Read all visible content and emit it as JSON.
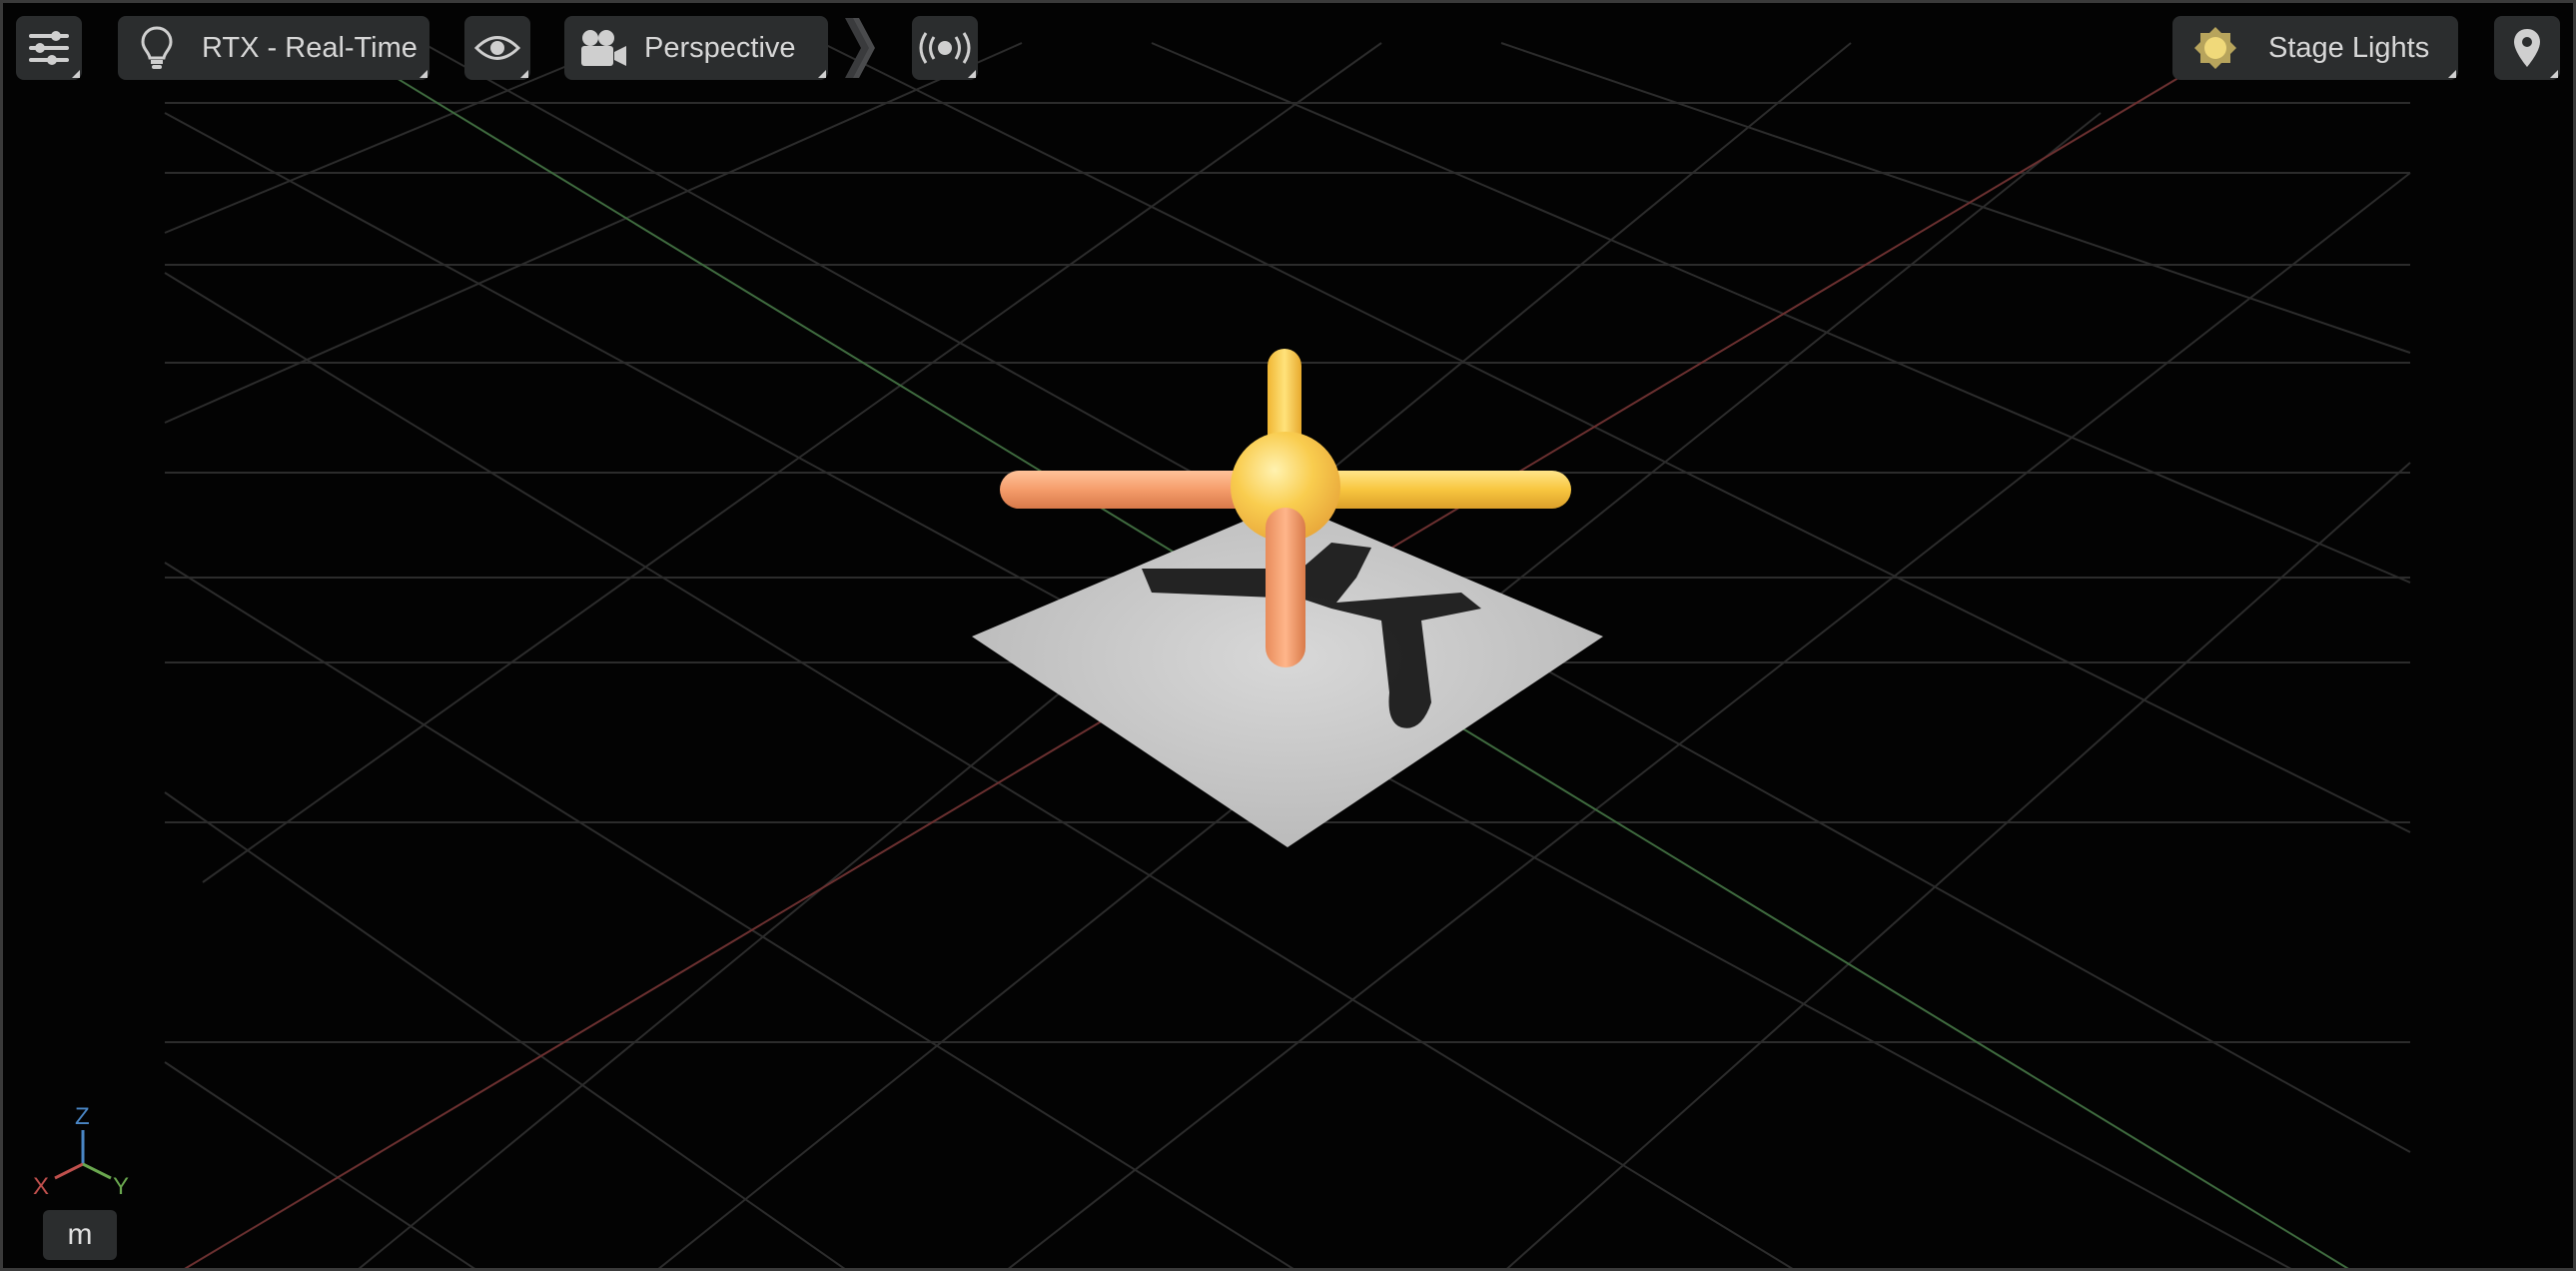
{
  "toolbar": {
    "renderer_label": "RTX - Real-Time",
    "camera_label": "Perspective",
    "lighting_label": "Stage Lights"
  },
  "icons": {
    "settings": "sliders-icon",
    "renderer": "lightbulb-icon",
    "visibility": "eye-icon",
    "camera": "movie-camera-icon",
    "expand": "chevron-right-double-icon",
    "broadcast": "broadcast-icon",
    "lighting": "sun-icon",
    "location": "map-pin-icon"
  },
  "gizmo": {
    "x_label": "X",
    "y_label": "Y",
    "z_label": "Z",
    "x_color": "#c0504d",
    "y_color": "#6aa84f",
    "z_color": "#4a86c5"
  },
  "unit": "m",
  "colors": {
    "toolbar_bg": "#2b2d2e",
    "text": "#d7d7d7",
    "object_yellow": "#f6c445",
    "object_orange": "#f4a071",
    "ground_plane": "#c9c9c9"
  }
}
